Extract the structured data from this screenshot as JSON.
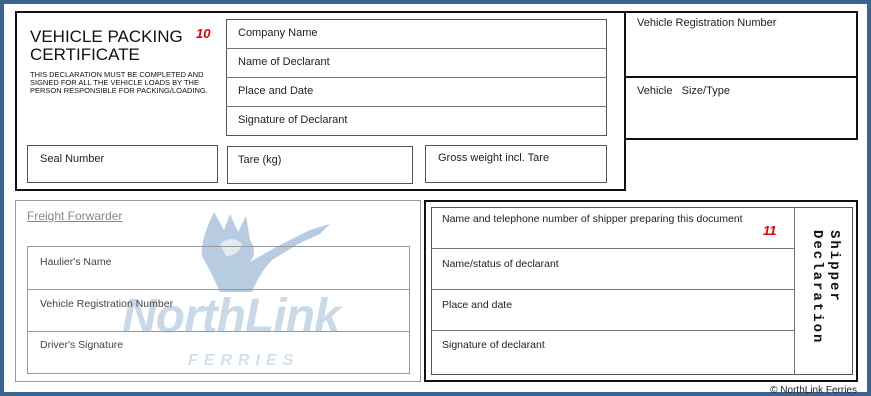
{
  "vpc": {
    "title_line1": "VEHICLE PACKING",
    "title_line2": "CERTIFICATE",
    "number": "10",
    "declaration_note": "THIS DECLARATION MUST BE COMPLETED AND SIGNED FOR ALL THE VEHICLE LOADS BY THE PERSON RESPONSIBLE FOR PACKING/LOADING.",
    "company_name": "Company Name",
    "name_of_declarant": "Name of Declarant",
    "place_and_date": "Place and Date",
    "signature_of_declarant": "Signature of Declarant",
    "seal_number": "Seal Number",
    "tare": "Tare (kg)",
    "gross_weight": "Gross weight incl. Tare"
  },
  "vehicle": {
    "registration_number": "Vehicle Registration Number",
    "size_type": "Vehicle   Size/Type"
  },
  "freight": {
    "title": "Freight Forwarder",
    "hauliers_name": "Haulier's Name",
    "vehicle_registration": "Vehicle Registration Number",
    "drivers_signature": "Driver's Signature",
    "logo_text": "NorthLink",
    "logo_subtext": "FERRIES"
  },
  "shipper": {
    "number": "11",
    "name_phone": "Name and telephone number of shipper preparing this document",
    "name_status": "Name/status of declarant",
    "place_date": "Place and date",
    "signature": "Signature of declarant",
    "side_label_line1": "Shipper",
    "side_label_line2": "Declaration"
  },
  "footer": {
    "copyright": "© NorthLink Ferries"
  },
  "colors": {
    "background": "#3a6591",
    "accent_red": "#e30000",
    "logo_blue": "#9fbbd6"
  }
}
